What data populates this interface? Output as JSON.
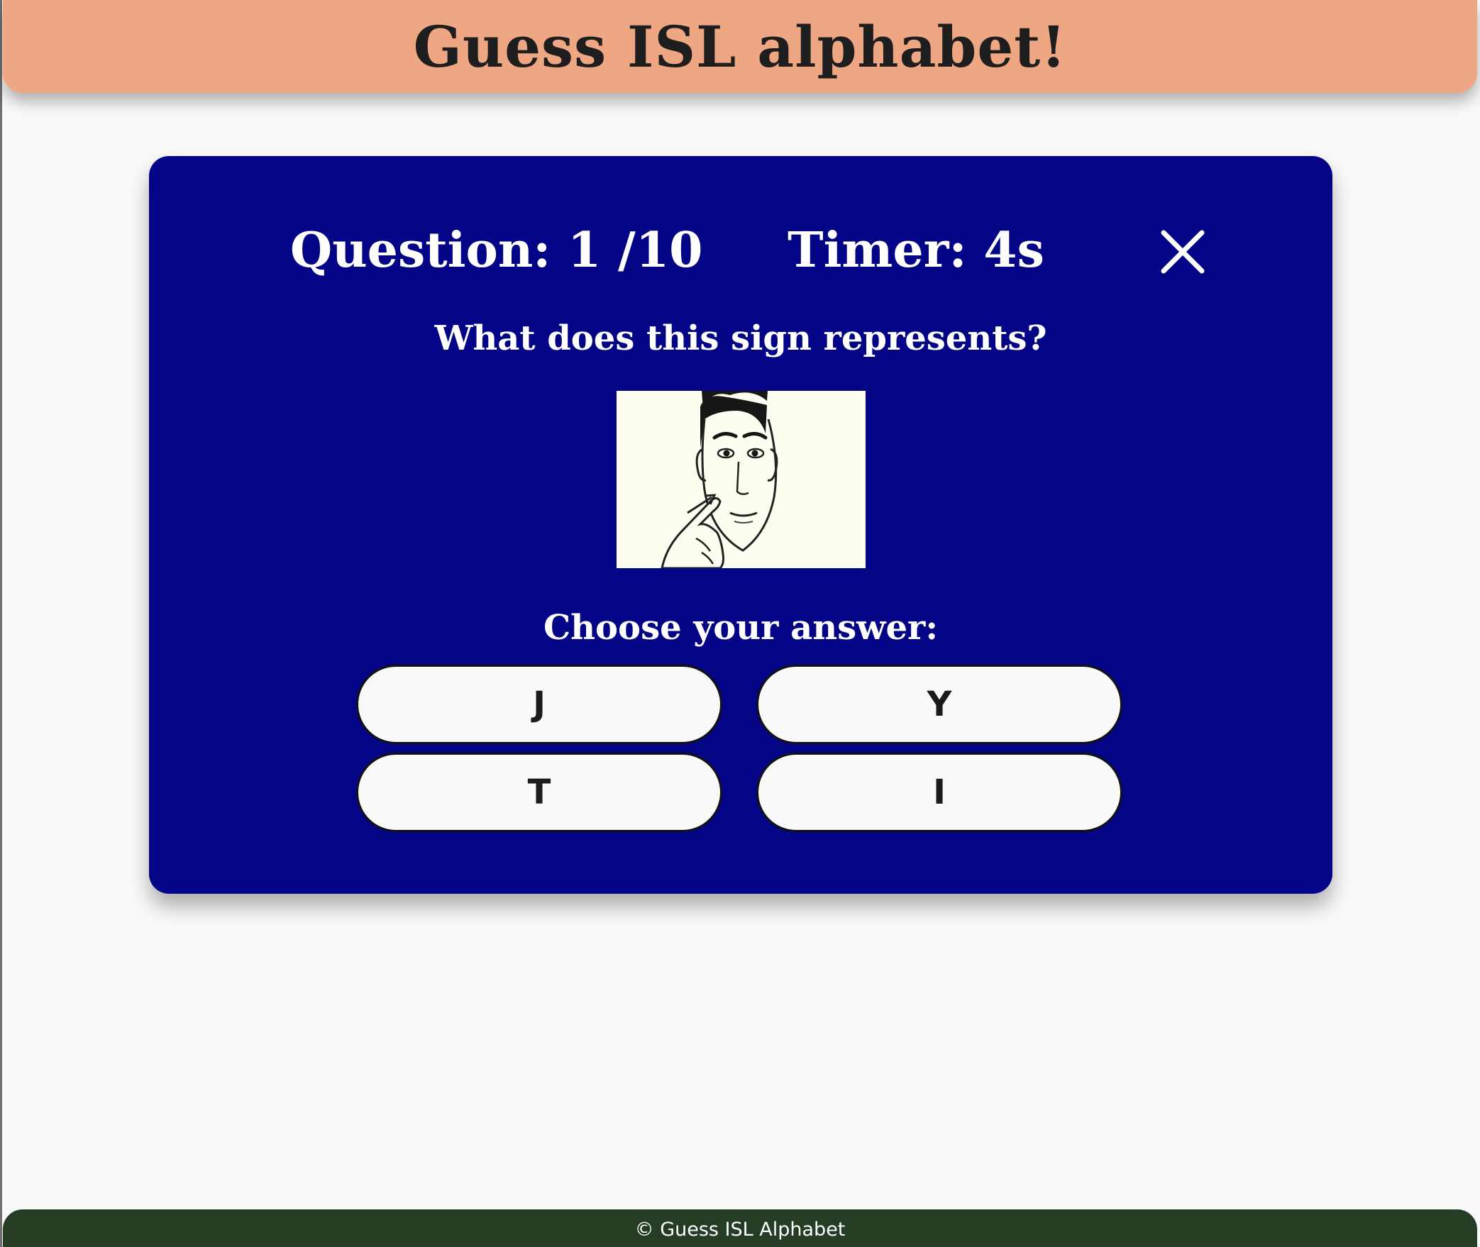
{
  "header": {
    "title": "Guess ISL alphabet!"
  },
  "quiz": {
    "question_counter": "Question: 1 /10",
    "timer": "Timer: 4s",
    "close_icon": "close-icon",
    "prompt": "What does this sign represents?",
    "sign_image": "face-sign-illustration",
    "answer_prompt": "Choose your answer:",
    "options": [
      "J",
      "Y",
      "T",
      "I"
    ]
  },
  "footer": {
    "text": "© Guess ISL Alphabet"
  },
  "colors": {
    "header_bg": "#eea683",
    "card_bg": "#040487",
    "footer_bg": "#243d24",
    "page_bg": "#f9f9f9",
    "button_bg": "#f9f9f9"
  }
}
